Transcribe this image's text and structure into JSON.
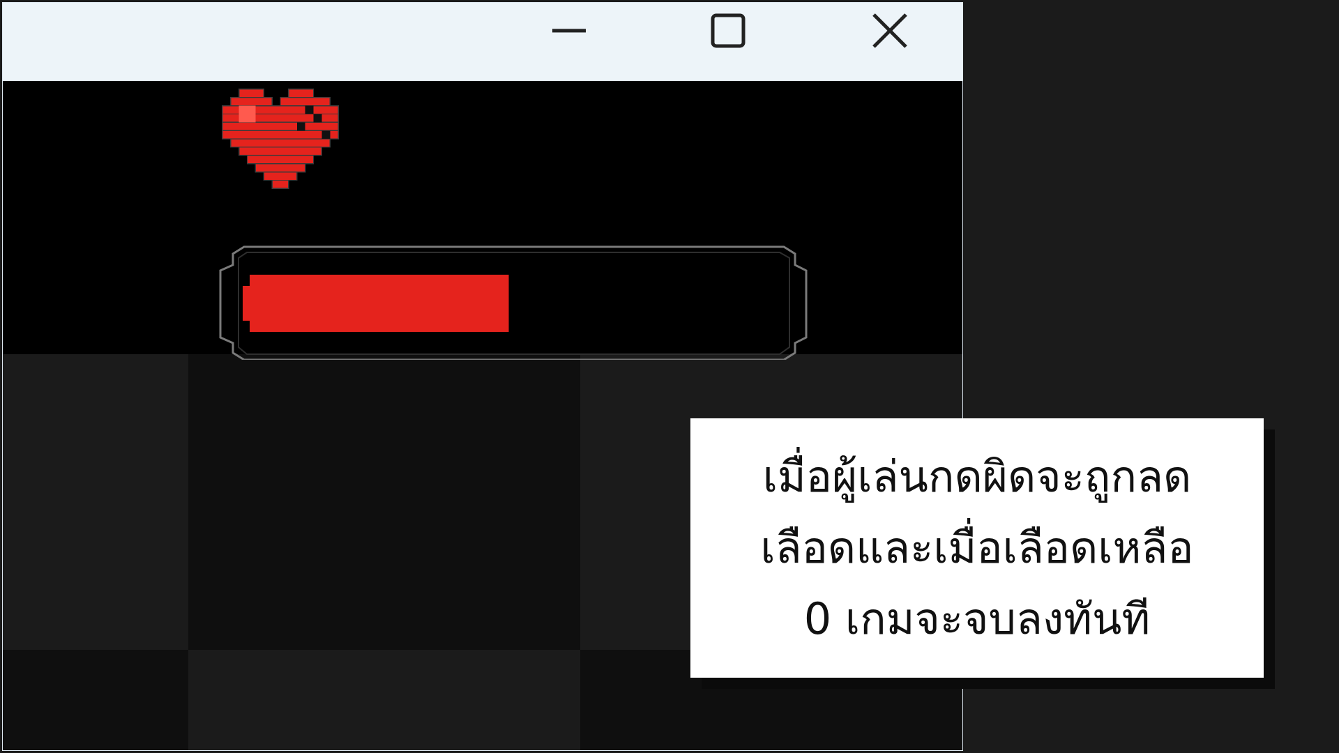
{
  "window": {
    "controls": {
      "minimize_icon": "minimize-icon",
      "maximize_icon": "maximize-icon",
      "close_icon": "close-icon"
    }
  },
  "game": {
    "health": {
      "icon": "pixel-heart-icon",
      "fill_fraction": 0.48,
      "fill_color": "#e5231d",
      "frame_color": "#7a7a7a"
    },
    "background": {
      "colors": [
        "#1b1b1b",
        "#0f0f0f"
      ]
    }
  },
  "caption": {
    "lines": [
      "เมื่อผู้เล่นกดผิดจะถูกลด",
      "เลือดและเมื่อเลือดเหลือ",
      "0 เกมจะจบลงทันที"
    ]
  }
}
